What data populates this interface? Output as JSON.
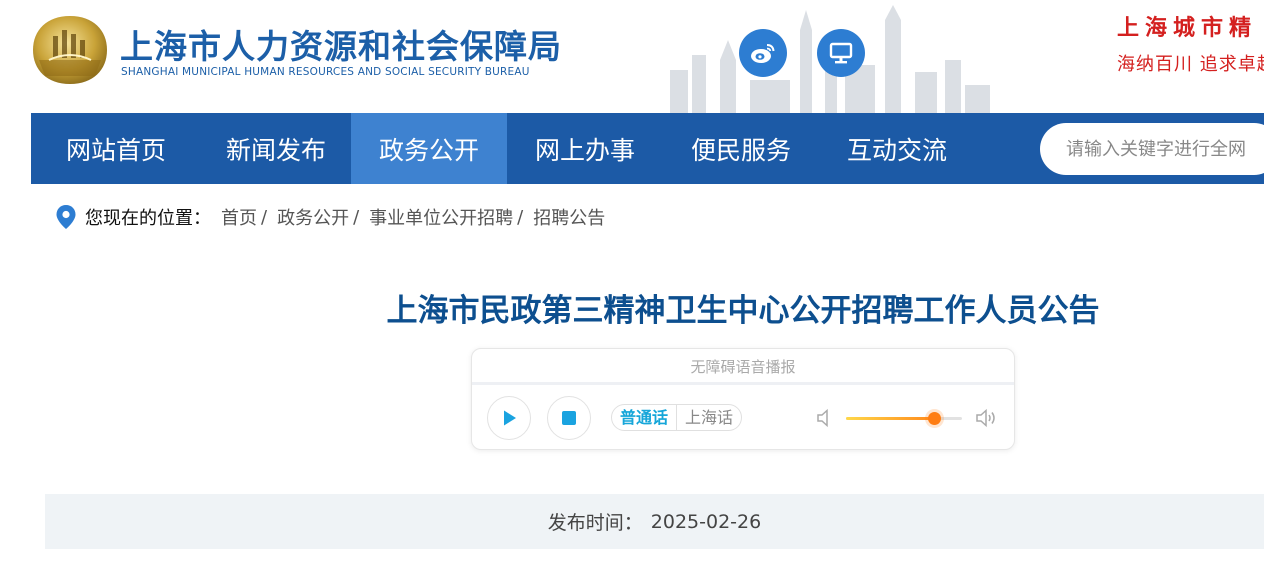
{
  "header": {
    "org_name_cn": "上海市人力资源和社会保障局",
    "org_name_en": "SHANGHAI MUNICIPAL HUMAN RESOURCES AND SOCIAL SECURITY BUREAU",
    "weibo_icon": "weibo-icon",
    "desktop_icon": "monitor-icon",
    "slogan_line1": "上海城市精",
    "slogan_line2": "海纳百川 追求卓越",
    "colors": {
      "brand_blue": "#1c5fa8",
      "slogan_red": "#d4201f"
    }
  },
  "nav": {
    "items": [
      {
        "label": "网站首页"
      },
      {
        "label": "新闻发布"
      },
      {
        "label": "政务公开"
      },
      {
        "label": "网上办事"
      },
      {
        "label": "便民服务"
      },
      {
        "label": "互动交流"
      }
    ],
    "active_label": "政务公开",
    "search_placeholder": "请输入关键字进行全网",
    "colors": {
      "bar": "#1c5aa6",
      "active": "#3e82d0"
    }
  },
  "breadcrumb": {
    "prefix": "您现在的位置：",
    "items": [
      {
        "label": "首页"
      },
      {
        "label": "政务公开"
      },
      {
        "label": "事业单位公开招聘"
      },
      {
        "label": "招聘公告"
      }
    ],
    "separator": "/",
    "icon": "location-pin-icon"
  },
  "article": {
    "title": "上海市民政第三精神卫生中心公开招聘工作人员公告",
    "publish_label": "发布时间：",
    "publish_date": "2025-02-26"
  },
  "player": {
    "title": "无障碍语音播报",
    "lang_selected": "普通话",
    "lang_other": "上海话",
    "volume_fraction": 0.76,
    "icons": [
      "play-icon",
      "stop-icon",
      "volume-low-icon",
      "volume-high-icon"
    ]
  }
}
